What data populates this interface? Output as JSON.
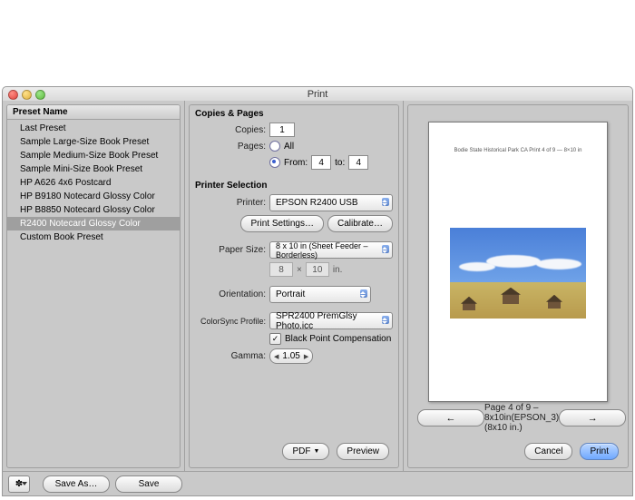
{
  "window": {
    "title": "Print"
  },
  "presets": {
    "header": "Preset Name",
    "items": [
      "Last Preset",
      "Sample Large-Size Book Preset",
      "Sample Medium-Size Book Preset",
      "Sample Mini-Size Book Preset",
      "HP A626 4x6 Postcard",
      "HP B9180 Notecard Glossy Color",
      "HP B8850 Notecard Glossy Color",
      "R2400 Notecard Glossy Color",
      "Custom Book Preset"
    ],
    "selected_index": 7
  },
  "copies_pages": {
    "title": "Copies & Pages",
    "copies_label": "Copies:",
    "copies_value": "1",
    "pages_label": "Pages:",
    "all_label": "All",
    "from_label": "From:",
    "from_value": "4",
    "to_label": "to:",
    "to_value": "4",
    "selected": "from"
  },
  "printer_selection": {
    "title": "Printer Selection",
    "printer_label": "Printer:",
    "printer_value": "EPSON R2400 USB",
    "print_settings_btn": "Print Settings…",
    "calibrate_btn": "Calibrate…",
    "paper_size_label": "Paper Size:",
    "paper_size_value": "8 x 10 in  (Sheet Feeder – Borderless)",
    "dim_w": "8",
    "dim_h": "10",
    "dim_unit": "in.",
    "orientation_label": "Orientation:",
    "orientation_value": "Portrait",
    "dim_sep": "×"
  },
  "colorsync": {
    "label": "ColorSync Profile:",
    "value": "SPR2400 PremGlsy Photo.icc",
    "bpc_label": "Black Point Compensation",
    "bpc_checked": true,
    "gamma_label": "Gamma:",
    "gamma_value": "1.05"
  },
  "preview": {
    "header_text": "Bodie State Historical Park CA     Print 4 of 9 — 8×10 in",
    "page_info": "Page 4 of 9 – 8x10in(EPSON_3) (8x10 in.)"
  },
  "buttons": {
    "save_as": "Save As…",
    "save": "Save",
    "pdf": "PDF",
    "preview": "Preview",
    "cancel": "Cancel",
    "print": "Print",
    "prev": "←",
    "next": "→"
  }
}
